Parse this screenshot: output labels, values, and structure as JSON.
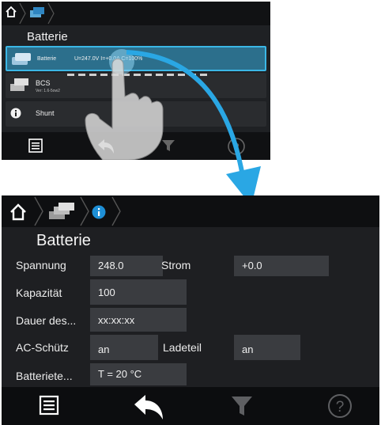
{
  "top_screen": {
    "title": "Batterie",
    "rows": [
      {
        "label": "Batterie",
        "detail": "U=247.0V   I=+0.0A   C=100%"
      },
      {
        "label": "BCS",
        "detail": "Ver: 1.6-5ow2"
      },
      {
        "label": "Shunt",
        "detail": ""
      }
    ]
  },
  "bottom_screen": {
    "title": "Batterie",
    "fields": {
      "spannung_label": "Spannung",
      "spannung_value": "248.0",
      "strom_label": "Strom",
      "strom_value": "+0.0",
      "kapazitaet_label": "Kapazität",
      "kapazitaet_value": "100",
      "dauer_label": "Dauer des...",
      "dauer_value": "xx:xx:xx",
      "ac_label": "AC-Schütz",
      "ac_value": "an",
      "ladeteil_label": "Ladeteil",
      "ladeteil_value": "an",
      "batterietemp_label": "Batteriete...",
      "batterietemp_value": "T = 20 °C"
    }
  },
  "icons": {
    "home": "home-icon",
    "battery": "battery-icon",
    "info": "info-icon",
    "list": "list-icon",
    "back": "back-icon",
    "filter": "filter-icon",
    "help": "help-icon",
    "help_glyph": "?"
  },
  "colors": {
    "accent": "#1e8fd6",
    "selected_row": "#2c6f8c",
    "arrow": "#2aa7e4"
  }
}
